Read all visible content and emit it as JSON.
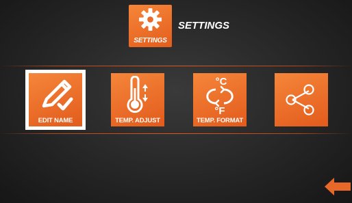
{
  "header": {
    "icon_caption": "SETTINGS",
    "icon_name": "gear-icon",
    "title": "SETTINGS"
  },
  "menu": {
    "items": [
      {
        "label": "EDIT NAME",
        "icon": "pencil-check-icon",
        "selected": true
      },
      {
        "label": "TEMP. ADJUST",
        "icon": "thermometer-icon",
        "selected": false
      },
      {
        "label": "TEMP. FORMAT",
        "icon": "celsius-fahrenheit-icon",
        "selected": false
      },
      {
        "label": "",
        "icon": "share-icon",
        "selected": false
      }
    ]
  },
  "navigation": {
    "back_icon": "back-arrow-icon"
  },
  "colors": {
    "accent": "#e8682a",
    "accent_light": "#f6863a",
    "selection_outline": "#ffffff",
    "background": "#2a2a2a",
    "text": "#ffffff"
  }
}
